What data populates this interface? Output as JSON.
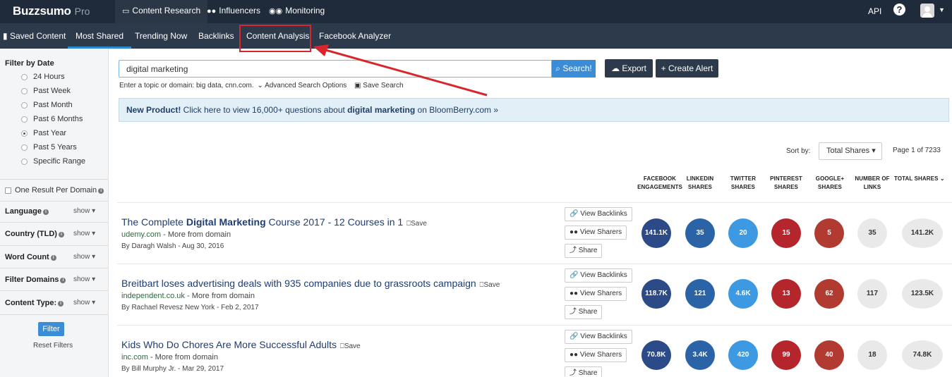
{
  "brand": {
    "name": "Buzzsumo",
    "tier": "Pro"
  },
  "topnav": [
    {
      "label": "Content Research",
      "icon": "monitor-icon"
    },
    {
      "label": "Influencers",
      "icon": "users-icon"
    },
    {
      "label": "Monitoring",
      "icon": "binoculars-icon"
    }
  ],
  "topright": {
    "api": "API",
    "help": "?"
  },
  "subnav": [
    "Saved Content",
    "Most Shared",
    "Trending Now",
    "Backlinks",
    "Content Analysis",
    "Facebook Analyzer"
  ],
  "sidebar": {
    "filter_by_date": "Filter by Date",
    "date_options": [
      "24 Hours",
      "Past Week",
      "Past Month",
      "Past 6 Months",
      "Past Year",
      "Past 5 Years",
      "Specific Range"
    ],
    "selected_date": "Past Year",
    "one_result": "One Result Per Domain",
    "filters": [
      {
        "label": "Language",
        "show": "show"
      },
      {
        "label": "Country (TLD)",
        "show": "show"
      },
      {
        "label": "Word Count",
        "show": "show"
      },
      {
        "label": "Filter Domains",
        "show": "show"
      },
      {
        "label": "Content Type:",
        "show": "show"
      }
    ],
    "filter_button": "Filter",
    "reset": "Reset Filters"
  },
  "search": {
    "value": "digital marketing",
    "button": "Search!",
    "export": "Export",
    "create_alert": "+ Create Alert",
    "hint": "Enter a topic or domain: big data, cnn.com.",
    "advanced": "Advanced Search Options",
    "save_search": "Save Search"
  },
  "banner": {
    "lead": "New Product!",
    "text_a": " Click here to view 16,000+ questions about ",
    "keyword": "digital marketing",
    "text_b": " on BloomBerry.com »"
  },
  "sort": {
    "label": "Sort by:",
    "selected": "Total Shares",
    "page": "Page 1 of 7233"
  },
  "columns": [
    [
      "FACEBOOK",
      "ENGAGEMENTS"
    ],
    [
      "LINKEDIN",
      "SHARES"
    ],
    [
      "TWITTER",
      "SHARES"
    ],
    [
      "PINTEREST",
      "SHARES"
    ],
    [
      "GOOGLE+",
      "SHARES"
    ],
    [
      "NUMBER OF",
      "LINKS"
    ],
    [
      "TOTAL SHARES",
      ""
    ]
  ],
  "actions": {
    "backlinks": "View Backlinks",
    "sharers": "View Sharers",
    "share": "Share",
    "save": "Save",
    "more": " - More from domain"
  },
  "rows": [
    {
      "title_pre": "The Complete ",
      "title_bold": "Digital Marketing",
      "title_post": " Course 2017 - 12 Courses in 1",
      "domain": "udemy.com",
      "byline": "By Daragh Walsh - Aug 30, 2016",
      "facebook": "141.1K",
      "linkedin": "35",
      "twitter": "20",
      "pinterest": "15",
      "googleplus": "5",
      "links": "35",
      "total": "141.2K"
    },
    {
      "title_pre": "Breitbart loses advertising deals with 935 companies due to grassroots campaign",
      "title_bold": "",
      "title_post": "",
      "domain": "independent.co.uk",
      "byline": "By Rachael Revesz New York - Feb 2, 2017",
      "facebook": "118.7K",
      "linkedin": "121",
      "twitter": "4.6K",
      "pinterest": "13",
      "googleplus": "62",
      "links": "117",
      "total": "123.5K"
    },
    {
      "title_pre": "Kids Who Do Chores Are More Successful Adults",
      "title_bold": "",
      "title_post": "",
      "domain": "inc.com",
      "byline": "By Bill Murphy Jr. - Mar 29, 2017",
      "facebook": "70.8K",
      "linkedin": "3.4K",
      "twitter": "420",
      "pinterest": "99",
      "googleplus": "40",
      "links": "18",
      "total": "74.8K"
    }
  ],
  "colors": {
    "topbar": "#1f2a3a",
    "subbar": "#2c3a4c",
    "accent": "#3a8cd6",
    "annotation": "#d9262c",
    "facebook": "#2c4a87",
    "linkedin": "#2b64a6",
    "twitter": "#3d9ae2",
    "pinterest": "#b5252c",
    "googleplus": "#b13a31"
  }
}
